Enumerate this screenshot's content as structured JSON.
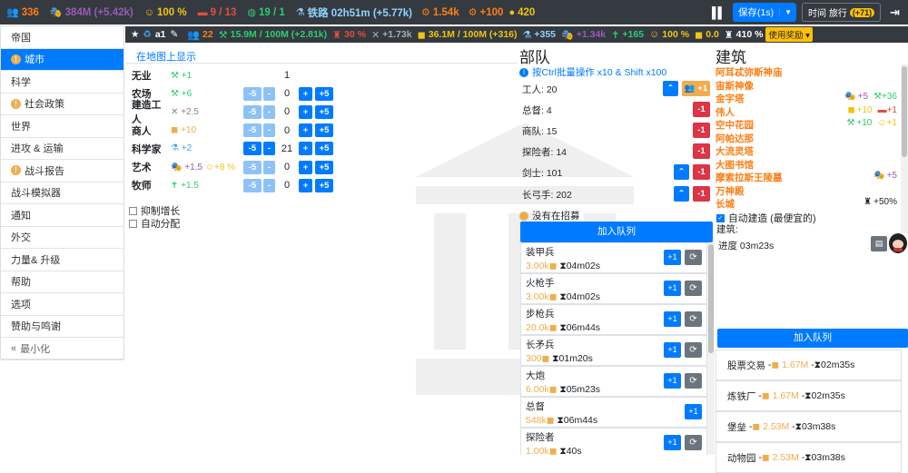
{
  "topbar": {
    "population": "336",
    "culture": "384M (+5.42k)",
    "happiness": "100 %",
    "housing": "9 / 13",
    "world": "19 / 1",
    "research": "铁路 02h51m (+5.77k)",
    "gear": "1.54k",
    "gear_plus": "+100",
    "bulb": "420",
    "save_label": "保存(1s)",
    "travel_label": "时间 旅行",
    "travel_badge": "(+71)"
  },
  "sidebar": {
    "items": [
      {
        "label": "帝国",
        "warn": false
      },
      {
        "label": "城市",
        "warn": true,
        "active": true
      },
      {
        "label": "科学",
        "warn": false
      },
      {
        "label": "社会政策",
        "warn": true
      },
      {
        "label": "世界",
        "warn": false
      },
      {
        "label": "进攻 & 运输",
        "warn": false
      },
      {
        "label": "战斗报告",
        "warn": true
      },
      {
        "label": "战斗模拟器",
        "warn": false
      },
      {
        "label": "通知",
        "warn": false
      },
      {
        "label": "外交",
        "warn": false
      },
      {
        "label": "力量& 升级",
        "warn": false
      },
      {
        "label": "帮助",
        "warn": false
      },
      {
        "label": "选项",
        "warn": false
      },
      {
        "label": "赞助与鸣谢",
        "warn": false
      },
      {
        "label": "最小化",
        "warn": false
      }
    ]
  },
  "secbar": {
    "city_name": "a1",
    "pop": "22",
    "science": "15.9M / 100M (+2.81k)",
    "military": "30 %",
    "tools": "+1.73k",
    "gold": "36.1M / 100M (+316)",
    "research": "+355",
    "culture": "+1.34k",
    "faith": "+165",
    "happy": "100 %",
    "coins": "0.0",
    "defense": "410 %",
    "reward": "使用奖励"
  },
  "city": {
    "map_link": "在地图上显示",
    "jobs": [
      {
        "name": "无业",
        "effect": "+1",
        "effect_color": "#2ecc71",
        "icon": "worker-icon",
        "count": "1",
        "buttons": false
      },
      {
        "name": "农场",
        "effect": "+6",
        "effect_color": "#2ecc71",
        "icon": "worker-icon",
        "count": "0",
        "buttons": true,
        "minus_light": true
      },
      {
        "name": "建造工人",
        "effect": "+2.5",
        "effect_color": "#888",
        "icon": "tools-icon",
        "count": "0",
        "buttons": true,
        "minus_light": true
      },
      {
        "name": "商人",
        "effect": "+10",
        "effect_color": "#f0ad4e",
        "icon": "coin-icon",
        "count": "0",
        "buttons": true,
        "minus_light": true
      },
      {
        "name": "科学家",
        "effect": "+2",
        "effect_color": "#3da5f4",
        "icon": "flask-icon",
        "count": "21",
        "buttons": true,
        "minus_light": false
      },
      {
        "name": "艺术",
        "effect": "+1.5",
        "effect2": "+8 %",
        "effect_color": "#9b59b6",
        "icon": "mask-icon",
        "count": "0",
        "buttons": true,
        "minus_light": true
      },
      {
        "name": "牧师",
        "effect": "+1.5",
        "effect_color": "#2ecc71",
        "icon": "priest-icon",
        "count": "0",
        "buttons": true,
        "minus_light": true
      }
    ],
    "minus5": "-5",
    "minus1": "-",
    "plus1": "+",
    "plus5": "+5",
    "check_suppress": "抑制增长",
    "check_auto": "自动分配"
  },
  "army": {
    "title": "部队",
    "hint": "按Ctrl批量操作 x10 & Shift x100",
    "units": [
      {
        "label": "工人: 20"
      },
      {
        "label": "总督: 4"
      },
      {
        "label": "商队: 15"
      },
      {
        "label": "探险者: 14"
      },
      {
        "label": "剑士: 101"
      },
      {
        "label": "长弓手: 202"
      }
    ],
    "worker_plus": "+1",
    "minus1": "-1",
    "no_recruit": "没有在招募",
    "add_queue": "加入队列",
    "queue": [
      {
        "name": "装甲兵",
        "cost": "3.00k",
        "time": "04m02s"
      },
      {
        "name": "火枪手",
        "cost": "3.00k",
        "time": "04m02s"
      },
      {
        "name": "步枪兵",
        "cost": "20.0k",
        "time": "06m44s"
      },
      {
        "name": "长矛兵",
        "cost": "300",
        "time": "01m20s"
      },
      {
        "name": "大炮",
        "cost": "6.00k",
        "time": "05m23s"
      },
      {
        "name": "总督",
        "cost": "548k",
        "time": "06m44s"
      },
      {
        "name": "探险者",
        "cost": "1.00k",
        "time": "40s"
      }
    ],
    "plus1": "+1",
    "refresh": "⟳"
  },
  "buildings": {
    "title": "建筑",
    "items": [
      {
        "name": "阿耳忒弥斯神庙"
      },
      {
        "name": "宙斯神像"
      },
      {
        "name": "金字塔",
        "eff": "+5",
        "eff2": "+36"
      },
      {
        "name": "伟人",
        "eff": "+10",
        "eff2": "+1"
      },
      {
        "name": "空中花园",
        "eff": "+10",
        "eff2": "+1"
      },
      {
        "name": "阿帕达那"
      },
      {
        "name": "大流灵塔"
      },
      {
        "name": "大图书馆"
      },
      {
        "name": "摩索拉斯王陵墓",
        "eff": "+5"
      },
      {
        "name": "万神殿"
      },
      {
        "name": "长城",
        "eff": "+50%"
      }
    ],
    "auto_build": "自动建造 (最便宜的)",
    "building_label": "建筑:",
    "progress": "进度 03m23s",
    "add_queue": "加入队列",
    "queue": [
      {
        "name": "股票交易",
        "cost": "1.67M",
        "time": "02m35s"
      },
      {
        "name": "炼铁厂",
        "cost": "1.67M",
        "time": "02m35s"
      },
      {
        "name": "堡垒",
        "cost": "2.53M",
        "time": "03m38s"
      },
      {
        "name": "动物园",
        "cost": "2.53M",
        "time": "03m38s"
      }
    ]
  },
  "colors": {
    "primary": "#007bff",
    "dark": "#343a40",
    "danger": "#dc3545",
    "warning": "#f0ad4e"
  }
}
